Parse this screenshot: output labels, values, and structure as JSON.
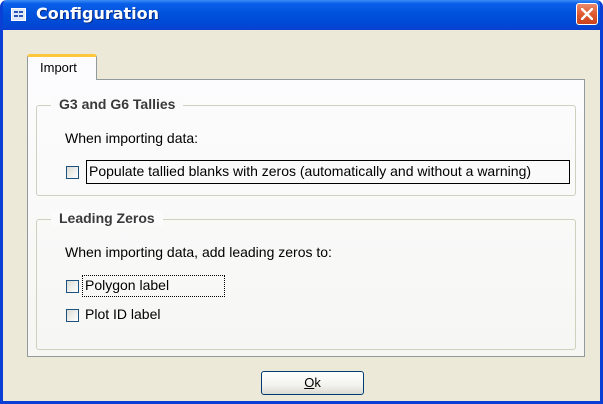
{
  "window": {
    "title": "Configuration",
    "close_label": "×"
  },
  "tabs": [
    {
      "label": "Import",
      "selected": true
    }
  ],
  "import_tab": {
    "tallies_group": {
      "title": "G3 and G6 Tallies",
      "description": "When importing data:",
      "options": [
        {
          "label": "Populate tallied blanks with zeros (automatically and without a warning)",
          "checked": false
        }
      ]
    },
    "leading_zeros_group": {
      "title": "Leading Zeros",
      "description": "When importing data, add leading zeros to:",
      "options": [
        {
          "label": "Polygon label",
          "checked": false
        },
        {
          "label": "Plot ID label",
          "checked": false
        }
      ]
    }
  },
  "footer": {
    "ok_mnemonic": "O",
    "ok_rest": "k"
  },
  "colors": {
    "titlebar": "#0052dc",
    "dialog_background": "#ece9d8",
    "tab_highlight": "#ffc83c",
    "close_button": "#e05a30"
  },
  "icons": {
    "app": "form-icon",
    "close": "close-x-icon"
  }
}
